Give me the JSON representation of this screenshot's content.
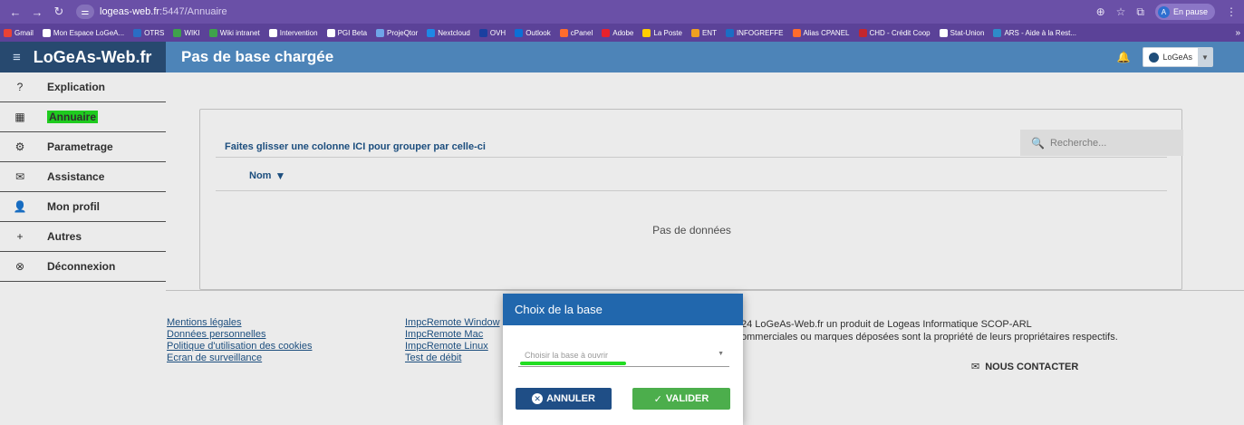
{
  "browser": {
    "url_host": "logeas-web.fr",
    "url_path": ":5447/Annuaire",
    "profile_initial": "A",
    "profile_label": "En pause",
    "bookmarks": [
      {
        "label": "Gmail",
        "color": "#e94235"
      },
      {
        "label": "Mon Espace LoGeA...",
        "color": "#ffffff"
      },
      {
        "label": "OTRS",
        "color": "#2a6dc4"
      },
      {
        "label": "WIKI",
        "color": "#3fa24c"
      },
      {
        "label": "Wiki intranet",
        "color": "#3fa24c"
      },
      {
        "label": "Intervention",
        "color": "#ffffff"
      },
      {
        "label": "PGI Beta",
        "color": "#ffffff"
      },
      {
        "label": "ProjeQtor",
        "color": "#6fa5e8"
      },
      {
        "label": "Nextcloud",
        "color": "#1e88e5"
      },
      {
        "label": "OVH",
        "color": "#1b3fa0"
      },
      {
        "label": "Outlook",
        "color": "#0b70d6"
      },
      {
        "label": "cPanel",
        "color": "#ff6c2c"
      },
      {
        "label": "Adobe",
        "color": "#e8212c"
      },
      {
        "label": "La Poste",
        "color": "#ffcc00"
      },
      {
        "label": "ENT",
        "color": "#f0a020"
      },
      {
        "label": "INFOGREFFE",
        "color": "#1b6ec4"
      },
      {
        "label": "Alias CPANEL",
        "color": "#ff6c2c"
      },
      {
        "label": "CHD - Crédit Coop",
        "color": "#c4262e"
      },
      {
        "label": "Stat-Union",
        "color": "#ffffff"
      },
      {
        "label": "ARS - Aide à la Rest...",
        "color": "#2e8bc9"
      }
    ]
  },
  "app": {
    "brand": "LoGeAs-Web.fr",
    "page_title": "Pas de base chargée",
    "org_label": "LoGeAs"
  },
  "sidebar": {
    "items": [
      {
        "label": "Explication",
        "icon": "help-circle-icon",
        "glyph": "?"
      },
      {
        "label": "Annuaire",
        "icon": "directory-icon",
        "glyph": "▦"
      },
      {
        "label": "Parametrage",
        "icon": "settings-gear-icon",
        "glyph": "⚙"
      },
      {
        "label": "Assistance",
        "icon": "envelope-icon",
        "glyph": "✉"
      },
      {
        "label": "Mon profil",
        "icon": "person-icon",
        "glyph": "👤"
      },
      {
        "label": "Autres",
        "icon": "plus-icon",
        "glyph": "+"
      },
      {
        "label": "Déconnexion",
        "icon": "logout-x-icon",
        "glyph": "⊗"
      }
    ]
  },
  "grid": {
    "group_hint": "Faites glisser une colonne ICI pour grouper par celle-ci",
    "search_placeholder": "Recherche...",
    "column_header": "Nom",
    "empty_text": "Pas de données"
  },
  "footer": {
    "links_col1": [
      "Mentions légales",
      "Données personnelles",
      "Politique d'utilisation des cookies",
      "Ecran de surveillance"
    ],
    "links_col2": [
      "ImpcRemote Window",
      "ImpcRemote Mac",
      "ImpcRemote Linux",
      "Test de débit"
    ],
    "copyright_line1": "24 LoGeAs-Web.fr un produit de Logeas Informatique SCOP-ARL",
    "copyright_line2": "ommerciales ou marques déposées sont la propriété de leurs propriétaires respectifs.",
    "contact_label": "NOUS CONTACTER"
  },
  "modal": {
    "title": "Choix de la base",
    "select_placeholder": "Choisir la base à ouvrir",
    "cancel_label": "ANNULER",
    "ok_label": "VALIDER"
  },
  "colors": {
    "browser_tab": "#6a50a7",
    "app_header": "#4d84b8",
    "brand_bg": "#27496f",
    "highlight": "#22dd22",
    "modal_header": "#2167ad",
    "cancel_button": "#1f4e86",
    "ok_button": "#4cae4c"
  }
}
